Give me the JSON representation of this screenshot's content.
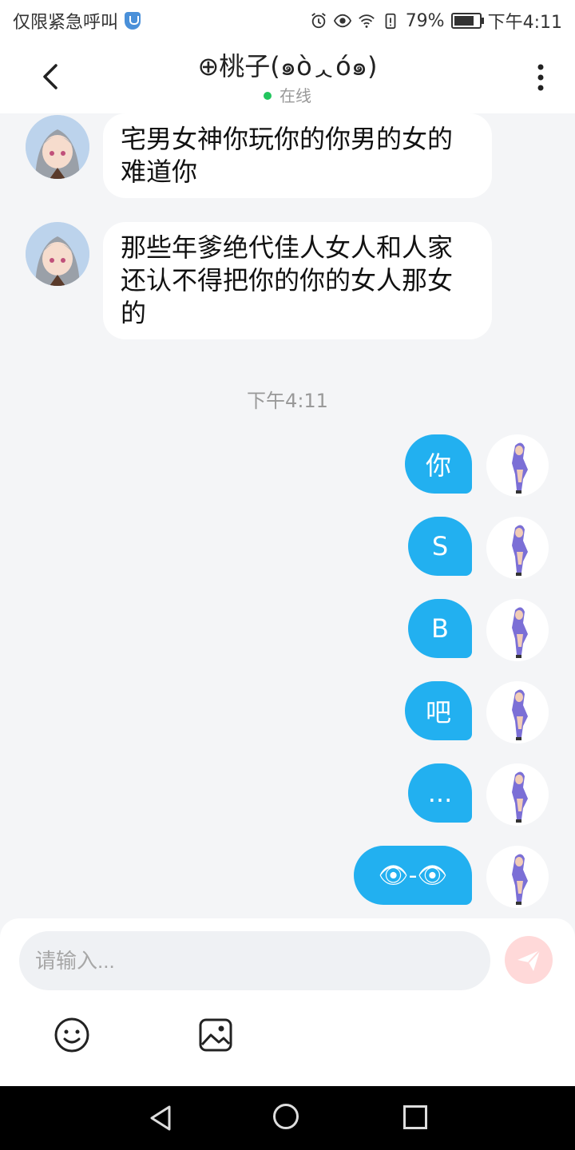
{
  "status_bar": {
    "carrier": "仅限紧急呼叫",
    "battery": "79%",
    "battery_level": 0.79,
    "time": "下午4:11"
  },
  "header": {
    "title": "⊕桃子(๑òᆺó๑)",
    "presence": "在线"
  },
  "incoming": [
    {
      "text": "宅男女神你玩你的你男的女的难道你"
    },
    {
      "text": "那些年爹绝代佳人女人和人家还认不得把你的你的女人那女的"
    }
  ],
  "timestamp": "下午4:11",
  "outgoing": [
    {
      "text": "你"
    },
    {
      "text": "S"
    },
    {
      "text": "B"
    },
    {
      "text": "吧"
    },
    {
      "text": "..."
    },
    {
      "text": "👁-👁"
    }
  ],
  "composer": {
    "placeholder": "请输入..."
  },
  "colors": {
    "accent": "#22b0f0",
    "online": "#22c55e",
    "send_disabled": "#ffd9d9"
  },
  "icons": [
    "shield-icon",
    "alarm-icon",
    "eye-icon",
    "wifi-icon",
    "battery-icon",
    "back-arrow-icon",
    "more-vertical-icon",
    "send-icon",
    "emoji-icon",
    "image-icon",
    "nav-back-icon",
    "nav-home-icon",
    "nav-recent-icon"
  ]
}
